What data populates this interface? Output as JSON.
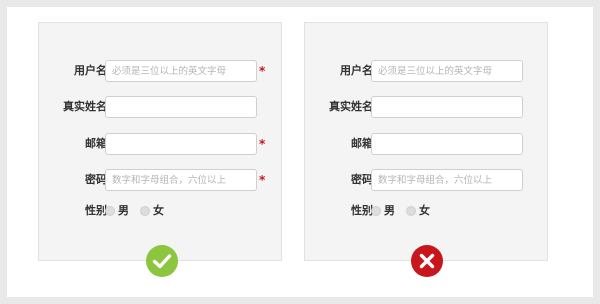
{
  "good_form": {
    "username_label": "用户名",
    "username_placeholder": "必须是三位以上的英文字母",
    "username_required": "*",
    "realname_label": "真实姓名",
    "email_label": "邮箱",
    "email_required": "*",
    "password_label": "密码",
    "password_placeholder": "数字和字母组合，六位以上",
    "password_required": "*",
    "gender_label": "性别",
    "gender_options": [
      "男",
      "女"
    ],
    "status_icon": "check-icon"
  },
  "bad_form": {
    "username_label": "用户名",
    "username_placeholder": "必须是三位以上的英文字母",
    "realname_label": "真实姓名",
    "email_label": "邮箱",
    "password_label": "密码",
    "password_placeholder": "数字和字母组合，六位以上",
    "gender_label": "性别",
    "gender_options": [
      "男",
      "女"
    ],
    "status_icon": "cross-icon"
  },
  "colors": {
    "required": "#c8161d",
    "ok": "#8cc63f",
    "bad": "#c8161d"
  }
}
